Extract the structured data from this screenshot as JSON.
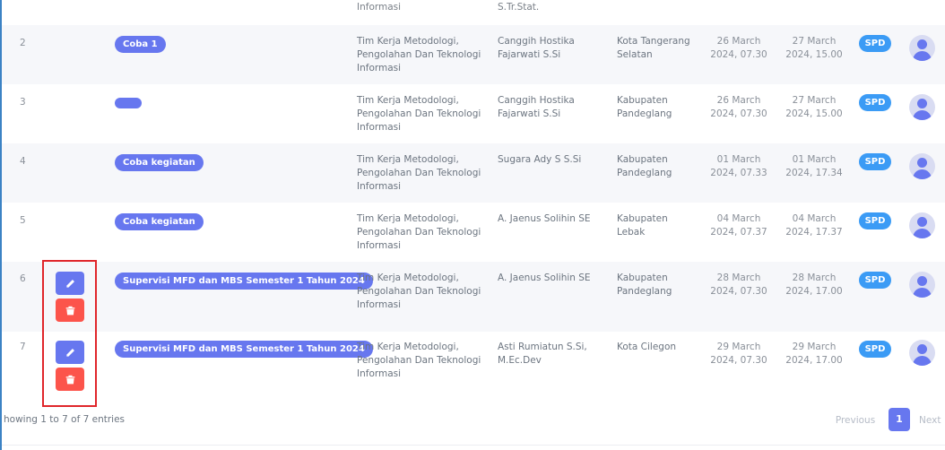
{
  "top_partial": {
    "unit": "Informasi",
    "person": "S.Tr.Stat."
  },
  "rows": [
    {
      "no": "2",
      "activity": "Coba 1",
      "unit": "Tim Kerja Metodologi, Pengolahan Dan Teknologi Informasi",
      "person": "Canggih Hostika Fajarwati S.Si",
      "location": "Kota Tangerang Selatan",
      "start": "26 March 2024, 07.30",
      "end": "27 March 2024, 15.00",
      "status": "SPD",
      "actions": false
    },
    {
      "no": "3",
      "activity": "",
      "unit": "Tim Kerja Metodologi, Pengolahan Dan Teknologi Informasi",
      "person": "Canggih Hostika Fajarwati S.Si",
      "location": "Kabupaten Pandeglang",
      "start": "26 March 2024, 07.30",
      "end": "27 March 2024, 15.00",
      "status": "SPD",
      "actions": false
    },
    {
      "no": "4",
      "activity": "Coba kegiatan",
      "unit": "Tim Kerja Metodologi, Pengolahan Dan Teknologi Informasi",
      "person": "Sugara Ady S S.Si",
      "location": "Kabupaten Pandeglang",
      "start": "01 March 2024, 07.33",
      "end": "01 March 2024, 17.34",
      "status": "SPD",
      "actions": false
    },
    {
      "no": "5",
      "activity": "Coba kegiatan",
      "unit": "Tim Kerja Metodologi, Pengolahan Dan Teknologi Informasi",
      "person": "A. Jaenus Solihin SE",
      "location": "Kabupaten Lebak",
      "start": "04 March 2024, 07.37",
      "end": "04 March 2024, 17.37",
      "status": "SPD",
      "actions": false
    },
    {
      "no": "6",
      "activity": "Supervisi MFD dan MBS Semester 1 Tahun 2024",
      "unit": "Tim Kerja Metodologi, Pengolahan Dan Teknologi Informasi",
      "person": "A. Jaenus Solihin SE",
      "location": "Kabupaten Pandeglang",
      "start": "28 March 2024, 07.30",
      "end": "28 March 2024, 17.00",
      "status": "SPD",
      "actions": true
    },
    {
      "no": "7",
      "activity": "Supervisi MFD dan MBS Semester 1 Tahun 2024",
      "unit": "Tim Kerja Metodologi, Pengolahan Dan Teknologi Informasi",
      "person": "Asti Rumiatun S.Si, M.Ec.Dev",
      "location": "Kota Cilegon",
      "start": "29 March 2024, 07.30",
      "end": "29 March 2024, 17.00",
      "status": "SPD",
      "actions": true
    }
  ],
  "footer": {
    "info": "howing 1 to 7 of 7 entries",
    "prev": "Previous",
    "page": "1",
    "next": "Next"
  },
  "icons": {
    "edit": "pencil-icon",
    "delete": "trash-icon",
    "avatar": "user-avatar-icon"
  },
  "colors": {
    "primary": "#6777ef",
    "info": "#3b9bf5",
    "danger": "#fc544b",
    "highlight": "#e0262b"
  }
}
